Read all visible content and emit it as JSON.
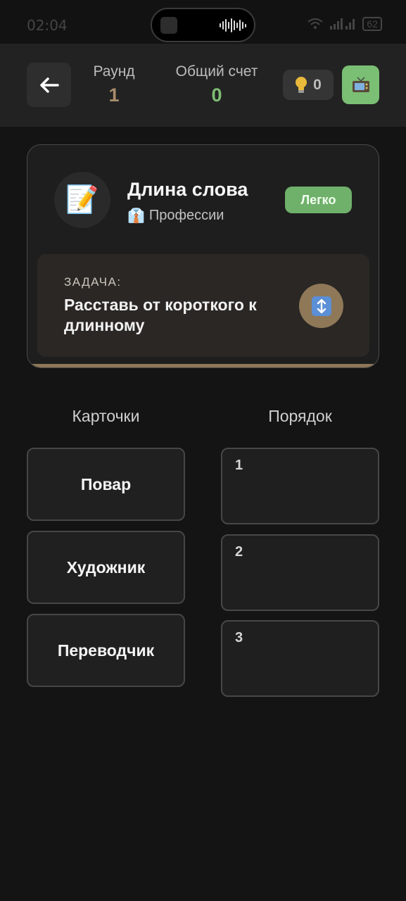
{
  "status_bar": {
    "time": "02:04",
    "battery": "62",
    "icons": [
      "key-icon",
      "eye-icon",
      "bluetooth-icon",
      "vpn-icon",
      "wifi-icon",
      "hd-icon",
      "signal-icon"
    ]
  },
  "header": {
    "round_label": "Раунд",
    "round_value": "1",
    "score_label": "Общий счет",
    "score_value": "0",
    "hints_count": "0",
    "colors": {
      "round": "#a88d6a",
      "score": "#7ebd72",
      "tv_button": "#7abf74"
    }
  },
  "task": {
    "emoji": "📝",
    "title": "Длина слова",
    "category_icon": "👔",
    "category": "Профессии",
    "difficulty": "Легко",
    "kicker": "ЗАДАЧА:",
    "text": "Расставь от короткого к длинному",
    "sort_icon": "↕",
    "colors": {
      "badge": "#6fb06a",
      "accent": "#8e7858"
    }
  },
  "columns": {
    "cards_title": "Карточки",
    "order_title": "Порядок"
  },
  "cards": [
    {
      "label": "Повар"
    },
    {
      "label": "Художник"
    },
    {
      "label": "Переводчик"
    }
  ],
  "slots": [
    {
      "number": "1"
    },
    {
      "number": "2"
    },
    {
      "number": "3"
    }
  ]
}
